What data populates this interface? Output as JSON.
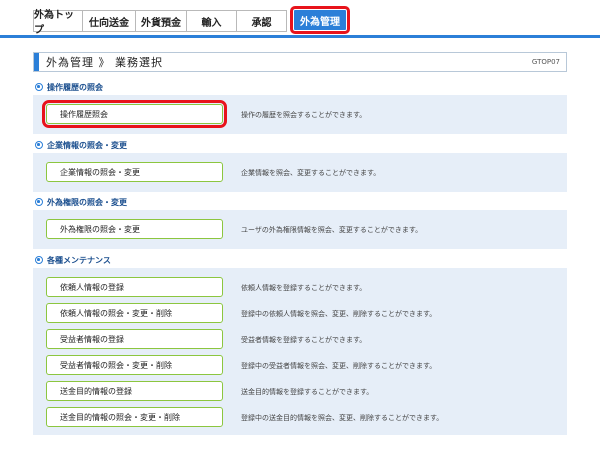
{
  "tabs": [
    {
      "label": "外為トップ"
    },
    {
      "label": "仕向送金"
    },
    {
      "label": "外貨預金"
    },
    {
      "label": "輸入"
    },
    {
      "label": "承認"
    },
    {
      "label": "外為管理"
    }
  ],
  "page": {
    "title": "外為管理 》 業務選択",
    "code": "GTOP07"
  },
  "sections": [
    {
      "heading": "操作履歴の照会",
      "items": [
        {
          "label": "操作履歴照会",
          "desc": "操作の履歴を照会することができます。"
        }
      ]
    },
    {
      "heading": "企業情報の照会・変更",
      "items": [
        {
          "label": "企業情報の照会・変更",
          "desc": "企業情報を照会、変更することができます。"
        }
      ]
    },
    {
      "heading": "外為権限の照会・変更",
      "items": [
        {
          "label": "外為権限の照会・変更",
          "desc": "ユーザの外為権限情報を照会、変更することができます。"
        }
      ]
    },
    {
      "heading": "各種メンテナンス",
      "items": [
        {
          "label": "依頼人情報の登録",
          "desc": "依頼人情報を登録することができます。"
        },
        {
          "label": "依頼人情報の照会・変更・削除",
          "desc": "登録中の依頼人情報を照会、変更、削除することができます。"
        },
        {
          "label": "受益者情報の登録",
          "desc": "受益者情報を登録することができます。"
        },
        {
          "label": "受益者情報の照会・変更・削除",
          "desc": "登録中の受益者情報を照会、変更、削除することができます。"
        },
        {
          "label": "送金目的情報の登録",
          "desc": "送金目的情報を登録することができます。"
        },
        {
          "label": "送金目的情報の照会・変更・削除",
          "desc": "登録中の送金目的情報を照会、変更、削除することができます。"
        }
      ]
    }
  ],
  "colors": {
    "accent": "#2b7fd8",
    "highlight": "#e8131b",
    "button_border": "#8cc63f",
    "section_bg": "#e6eef8"
  }
}
